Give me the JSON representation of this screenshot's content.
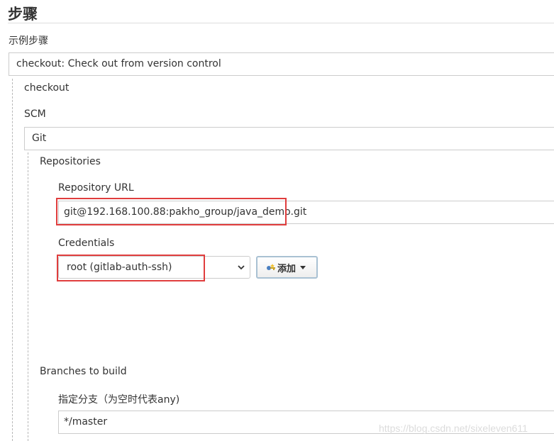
{
  "section_title": "步骤",
  "sample_step": {
    "label": "示例步骤",
    "value": "checkout: Check out from version control"
  },
  "checkout_label": "checkout",
  "scm": {
    "label": "SCM",
    "value": "Git"
  },
  "repositories": {
    "label": "Repositories",
    "url_label": "Repository URL",
    "url_value": "git@192.168.100.88:pakho_group/java_demo.git",
    "credentials_label": "Credentials",
    "credentials_value": "root (gitlab-auth-ssh)",
    "add_button_label": "添加"
  },
  "branches": {
    "label": "Branches to build",
    "specifier_label": "指定分支（为空时代表any)",
    "specifier_value": "*/master"
  },
  "watermark": "https://blog.csdn.net/sixeleven611",
  "colors": {
    "highlight": "#e03d3d",
    "border": "#cccccc",
    "add_button_border": "#a9c1d3"
  }
}
